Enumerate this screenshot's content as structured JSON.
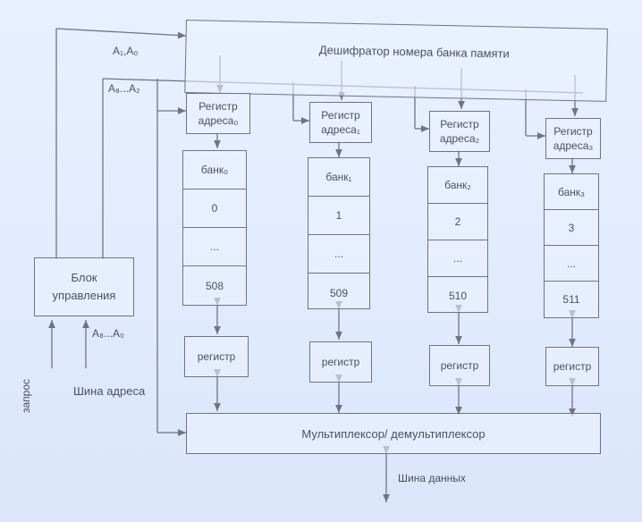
{
  "decoder": {
    "label": "Дешифратор номера банка памяти",
    "addr_label": "A₁,A₀"
  },
  "upper_addr": {
    "label": "A₈...A₂"
  },
  "control": {
    "label_line1": "Блок",
    "label_line2": "управления",
    "addr_in": "A₈...A₀"
  },
  "inputs": {
    "request": "запрос",
    "address_bus": "Шина адреса"
  },
  "banks": [
    {
      "reg_line1": "Регистр",
      "reg_line2": "адреса₀",
      "name": "банк₀",
      "cells": [
        "0",
        "...",
        "508"
      ],
      "data_reg": "регистр"
    },
    {
      "reg_line1": "Регистр",
      "reg_line2": "адреса₁",
      "name": "банк₁",
      "cells": [
        "1",
        "...",
        "509"
      ],
      "data_reg": "регистр"
    },
    {
      "reg_line1": "Регистр",
      "reg_line2": "адреса₂",
      "name": "банк₂",
      "cells": [
        "2",
        "...",
        "510"
      ],
      "data_reg": "регистр"
    },
    {
      "reg_line1": "Регистр",
      "reg_line2": "адреса₃",
      "name": "банк₃",
      "cells": [
        "3",
        "...",
        "511"
      ],
      "data_reg": "регистр"
    }
  ],
  "mux": {
    "label": "Мультиплексор/ демультиплексор"
  },
  "data_bus": {
    "label": "Шина данных"
  }
}
